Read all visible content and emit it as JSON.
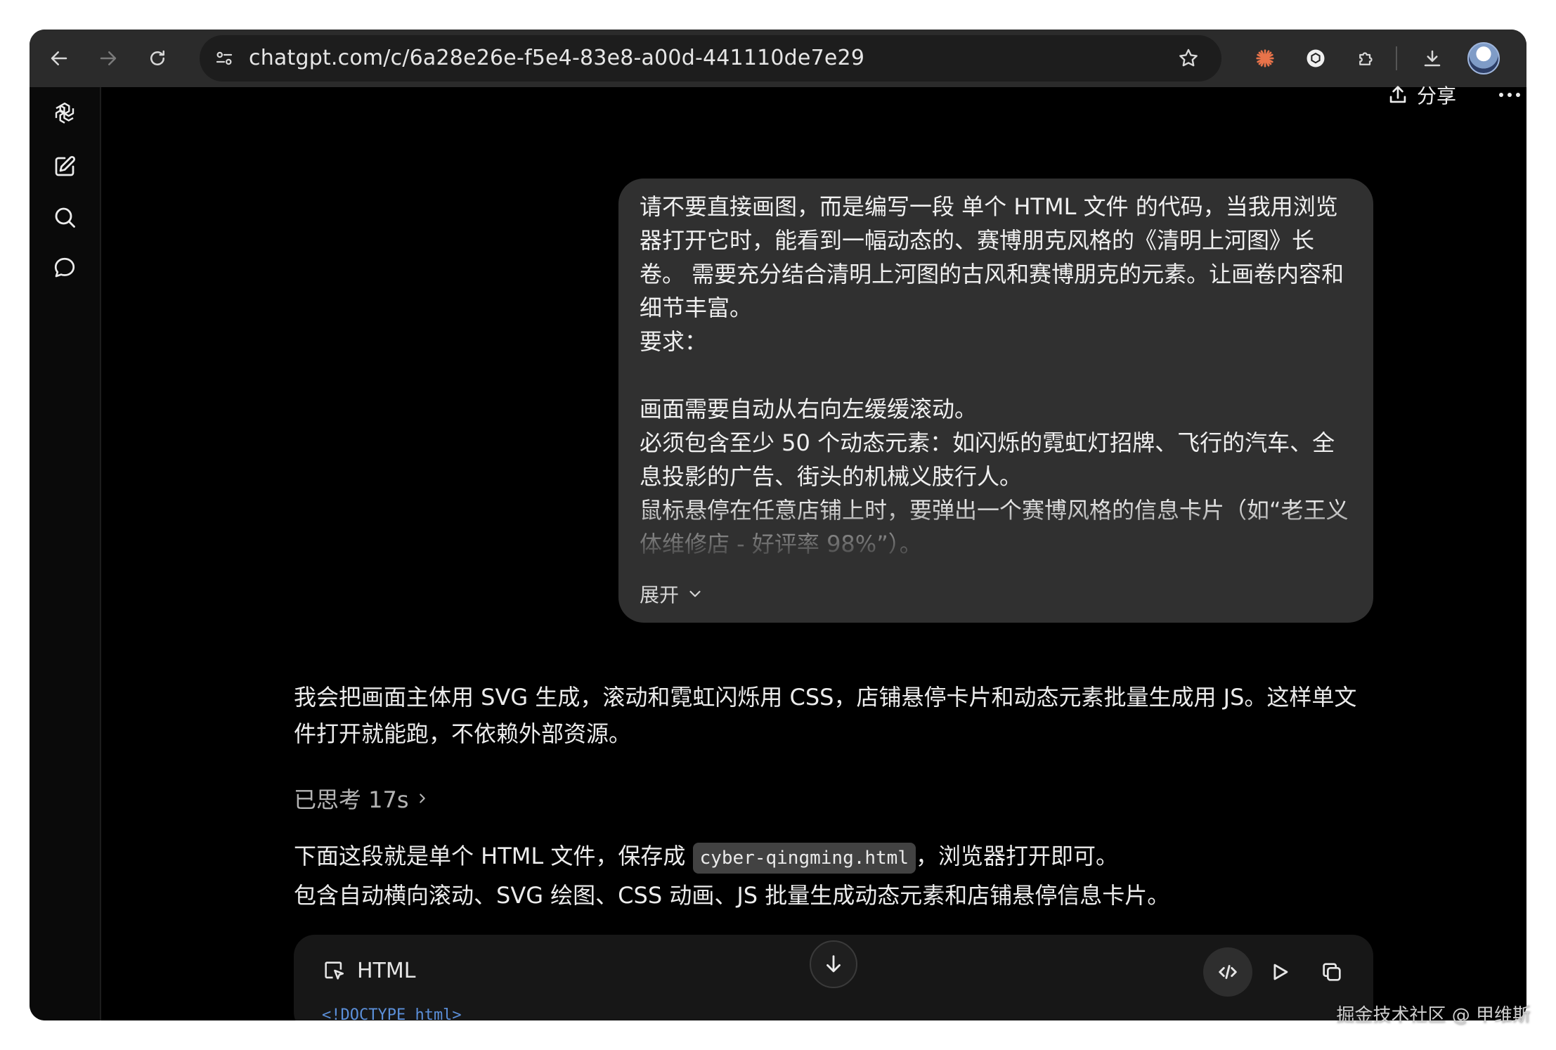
{
  "browser": {
    "url": "chatgpt.com/c/6a28e26e-f5e4-83e8-a00d-441110de7e29",
    "icons": [
      "back-icon",
      "forward-icon",
      "reload-icon",
      "site-controls-icon",
      "bookmark-star-icon",
      "claude-extension-icon",
      "gpt-extension-icon",
      "extensions-puzzle-icon",
      "download-icon",
      "profile-avatar"
    ]
  },
  "sidebar": {
    "icons": [
      "openai-logo-icon",
      "new-chat-icon",
      "search-icon",
      "chat-bubble-icon"
    ]
  },
  "header": {
    "share_label": "分享"
  },
  "user_message": {
    "lines": [
      "请不要直接画图，而是编写一段 单个 HTML 文件 的代码，当我用浏览器打开它时，能看到一幅动态的、赛博朋克风格的《清明上河图》长卷。 需要充分结合清明上河图的古风和赛博朋克的元素。让画卷内容和细节丰富。",
      "要求：",
      "",
      "画面需要自动从右向左缓缓滚动。",
      "必须包含至少 50 个动态元素：如闪烁的霓虹灯招牌、飞行的汽车、全息投影的广告、街头的机械义肢行人。",
      "鼠标悬停在任意店铺上时，要弹出一个赛博风格的信息卡片（如“老王义体维修店 - 好评率 98%”）。"
    ],
    "expand_label": "展开"
  },
  "assistant": {
    "intro": "我会把画面主体用 SVG 生成，滚动和霓虹闪烁用 CSS，店铺悬停卡片和动态元素批量生成用 JS。这样单文件打开就能跑，不依赖外部资源。",
    "thought_label": "已思考 17s",
    "p2_before": "下面这段就是单个 HTML 文件，保存成 ",
    "p2_filename": "cyber-qingming.html",
    "p2_after": "，浏览器打开即可。",
    "p3": "包含自动横向滚动、SVG 绘图、CSS 动画、JS 批量生成动态元素和店铺悬停信息卡片。"
  },
  "code_block": {
    "language": "HTML",
    "first_line": "<!DOCTYPE html>"
  },
  "watermark": "掘金技术社区 @ 甲维斯",
  "colors": {
    "window_bg": "#000000",
    "toolbar_bg": "#2b2b2b",
    "bubble_bg": "#303030",
    "code_bg": "#171717",
    "claude_accent": "#e8734a",
    "code_keyword": "#5b8fd9"
  }
}
